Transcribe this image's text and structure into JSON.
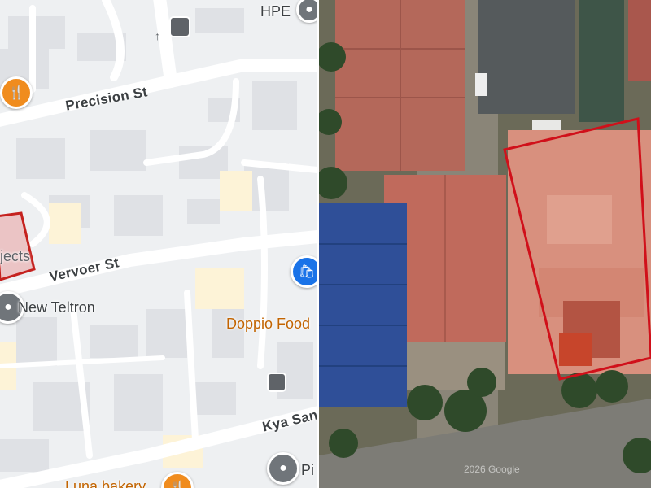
{
  "map": {
    "roads": {
      "precision": "Precision St",
      "vervoer": "Vervoer St",
      "kya_sand": "Kya San"
    },
    "pois": {
      "hpe": "HPE",
      "new_teltron": "New Teltron",
      "doppio": "Doppio Food",
      "partial_objects": "jects",
      "partial_pin": "Pi",
      "bakery": "Luna bakery"
    },
    "colors": {
      "road": "#ffffff",
      "block": "#dadce0",
      "highlight": "#c5221f",
      "food_pin": "#f08c1e",
      "grey_pin": "#70757a",
      "shopping_pin": "#1a73e8",
      "poi_orange": "#c26401"
    }
  },
  "satellite": {
    "watermark": "2026 Google",
    "highlight_color": "#d0101a"
  }
}
